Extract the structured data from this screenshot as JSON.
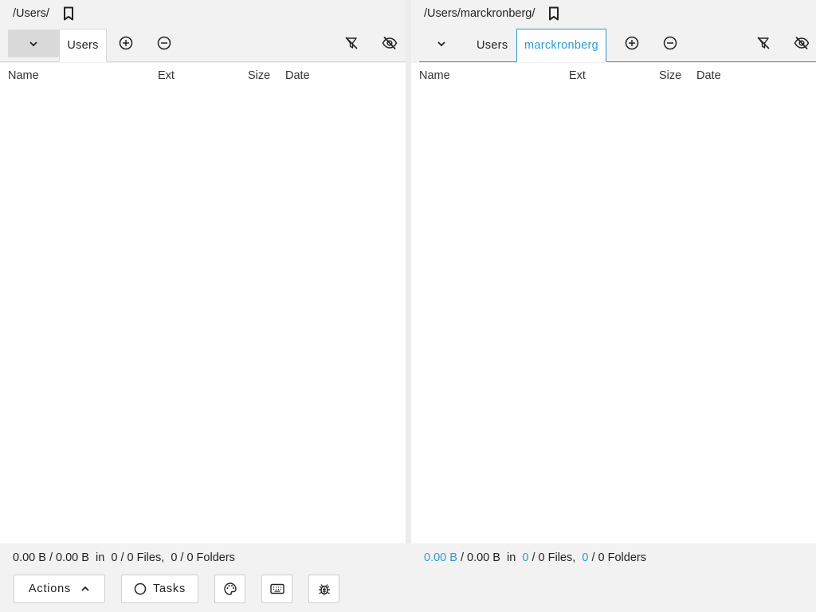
{
  "left": {
    "path": "/Users/",
    "tabs": [
      {
        "label": "Users"
      }
    ],
    "columns": {
      "name": "Name",
      "ext": "Ext",
      "size": "Size",
      "date": "Date"
    },
    "status": {
      "selected_size": "0.00 B",
      "total_size": "0.00 B",
      "in": "in",
      "files": "0 / 0 Files,",
      "folders": "0 / 0 Folders"
    }
  },
  "right": {
    "path": "/Users/marckronberg/",
    "tabs": [
      {
        "label": "Users"
      },
      {
        "label": "marckronberg"
      }
    ],
    "columns": {
      "name": "Name",
      "ext": "Ext",
      "size": "Size",
      "date": "Date"
    },
    "status": {
      "selected_size": "0.00 B",
      "total_size": "0.00 B",
      "in": "in",
      "files_selected": "0",
      "files_total": "0 Files,",
      "folders_selected": "0",
      "folders_total": "0 Folders"
    }
  },
  "bottom": {
    "actions_label": "Actions",
    "tasks_label": "Tasks"
  },
  "colors": {
    "accent": "#2a9bd0",
    "panel_bg": "#f2f2f2"
  }
}
